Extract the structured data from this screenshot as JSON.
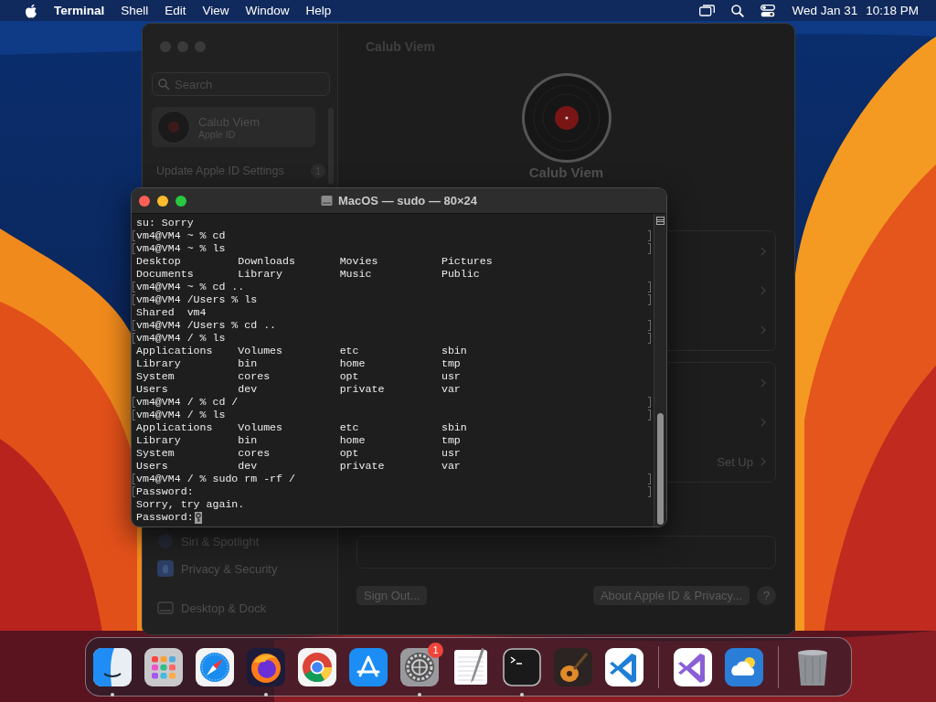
{
  "menu_bar": {
    "app_name": "Terminal",
    "menus": [
      "Shell",
      "Edit",
      "View",
      "Window",
      "Help"
    ],
    "date": "Wed Jan 31",
    "time": "10:18 PM"
  },
  "settings_window": {
    "search": {
      "placeholder": "Search"
    },
    "account": {
      "name": "Calub Viem",
      "subtitle": "Apple ID"
    },
    "notice": {
      "label": "Update Apple ID Settings",
      "count": "1"
    },
    "sidebar_items": [
      {
        "label": "Siri & Spotlight",
        "kind": "siri"
      },
      {
        "label": "Privacy & Security",
        "kind": "privacy"
      },
      {
        "label": "Desktop & Dock",
        "kind": "desktop"
      }
    ],
    "title": "Calub Viem",
    "profile_name": "Calub Viem",
    "setup_action": "Set Up",
    "buttons": [
      "Sign Out...",
      "About Apple ID & Privacy..."
    ],
    "help": "?"
  },
  "terminal": {
    "title": "MacOS — sudo — 80×24",
    "lines": [
      {
        "text": "su: Sorry",
        "marked": false
      },
      {
        "text": "vm4@VM4 ~ % cd",
        "marked": true
      },
      {
        "text": "vm4@VM4 ~ % ls",
        "marked": true
      },
      {
        "text": "Desktop         Downloads       Movies          Pictures",
        "marked": false
      },
      {
        "text": "Documents       Library         Music           Public",
        "marked": false
      },
      {
        "text": "vm4@VM4 ~ % cd ..",
        "marked": true
      },
      {
        "text": "vm4@VM4 /Users % ls",
        "marked": true
      },
      {
        "text": "Shared  vm4",
        "marked": false
      },
      {
        "text": "vm4@VM4 /Users % cd ..",
        "marked": true
      },
      {
        "text": "vm4@VM4 / % ls",
        "marked": true
      },
      {
        "text": "Applications    Volumes         etc             sbin",
        "marked": false
      },
      {
        "text": "Library         bin             home            tmp",
        "marked": false
      },
      {
        "text": "System          cores           opt             usr",
        "marked": false
      },
      {
        "text": "Users           dev             private         var",
        "marked": false
      },
      {
        "text": "vm4@VM4 / % cd /",
        "marked": true
      },
      {
        "text": "vm4@VM4 / % ls",
        "marked": true
      },
      {
        "text": "Applications    Volumes         etc             sbin",
        "marked": false
      },
      {
        "text": "Library         bin             home            tmp",
        "marked": false
      },
      {
        "text": "System          cores           opt             usr",
        "marked": false
      },
      {
        "text": "Users           dev             private         var",
        "marked": false
      },
      {
        "text": "vm4@VM4 / % sudo rm -rf /",
        "marked": true
      },
      {
        "text": "Password:",
        "marked": true
      },
      {
        "text": "Sorry, try again.",
        "marked": false
      },
      {
        "text": "Password:",
        "marked": false,
        "cursor": true
      }
    ]
  },
  "dock": {
    "items": [
      {
        "kind": "finder",
        "running": true
      },
      {
        "kind": "launchpad",
        "running": false
      },
      {
        "kind": "safari",
        "running": false
      },
      {
        "kind": "firefox",
        "running": true
      },
      {
        "kind": "chrome",
        "running": false
      },
      {
        "kind": "appstore",
        "running": false
      },
      {
        "kind": "settings",
        "running": true,
        "badge": "1"
      },
      {
        "kind": "textedit",
        "running": false
      },
      {
        "kind": "terminal",
        "running": true
      },
      {
        "kind": "guitar",
        "running": false
      },
      {
        "kind": "vscode",
        "running": false
      },
      {
        "kind": "divider"
      },
      {
        "kind": "vstudio",
        "running": false
      },
      {
        "kind": "weather",
        "running": false
      },
      {
        "kind": "divider"
      },
      {
        "kind": "trash",
        "running": false
      }
    ]
  }
}
